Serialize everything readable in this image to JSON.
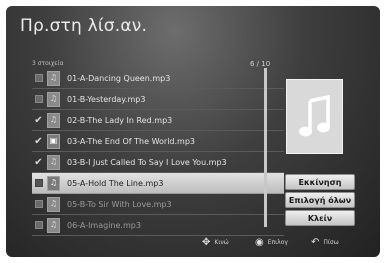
{
  "header": {
    "title": "Πρ.στη λίσ.αν."
  },
  "list_meta": {
    "count_label": "3 στοιχεία",
    "page_indicator": "6 / 10"
  },
  "rows": [
    {
      "label": "01-A-Dancing Queen.mp3",
      "checked": false,
      "icon": "music"
    },
    {
      "label": "01-B-Yesterday.mp3",
      "checked": false,
      "icon": "music"
    },
    {
      "label": "02-B-The Lady In Red.mp3",
      "checked": true,
      "icon": "music"
    },
    {
      "label": "03-A-The End Of The World.mp3",
      "checked": true,
      "icon": "picture"
    },
    {
      "label": "03-B-I Just Called To Say I Love You.mp3",
      "checked": true,
      "icon": "music"
    },
    {
      "label": "05-A-Hold The Line.mp3",
      "checked": false,
      "icon": "music",
      "selected": true
    },
    {
      "label": "05-B-To Sir With Love.mp3",
      "checked": false,
      "icon": "music"
    },
    {
      "label": "06-A-Imagine.mp3",
      "checked": false,
      "icon": "music"
    }
  ],
  "buttons": {
    "play": "Εκκίνηση",
    "select_all": "Επιλογή όλων",
    "close": "Κλείν"
  },
  "footer": {
    "move": "Κινώ",
    "select": "Επιλογ",
    "back": "Πίσω"
  }
}
